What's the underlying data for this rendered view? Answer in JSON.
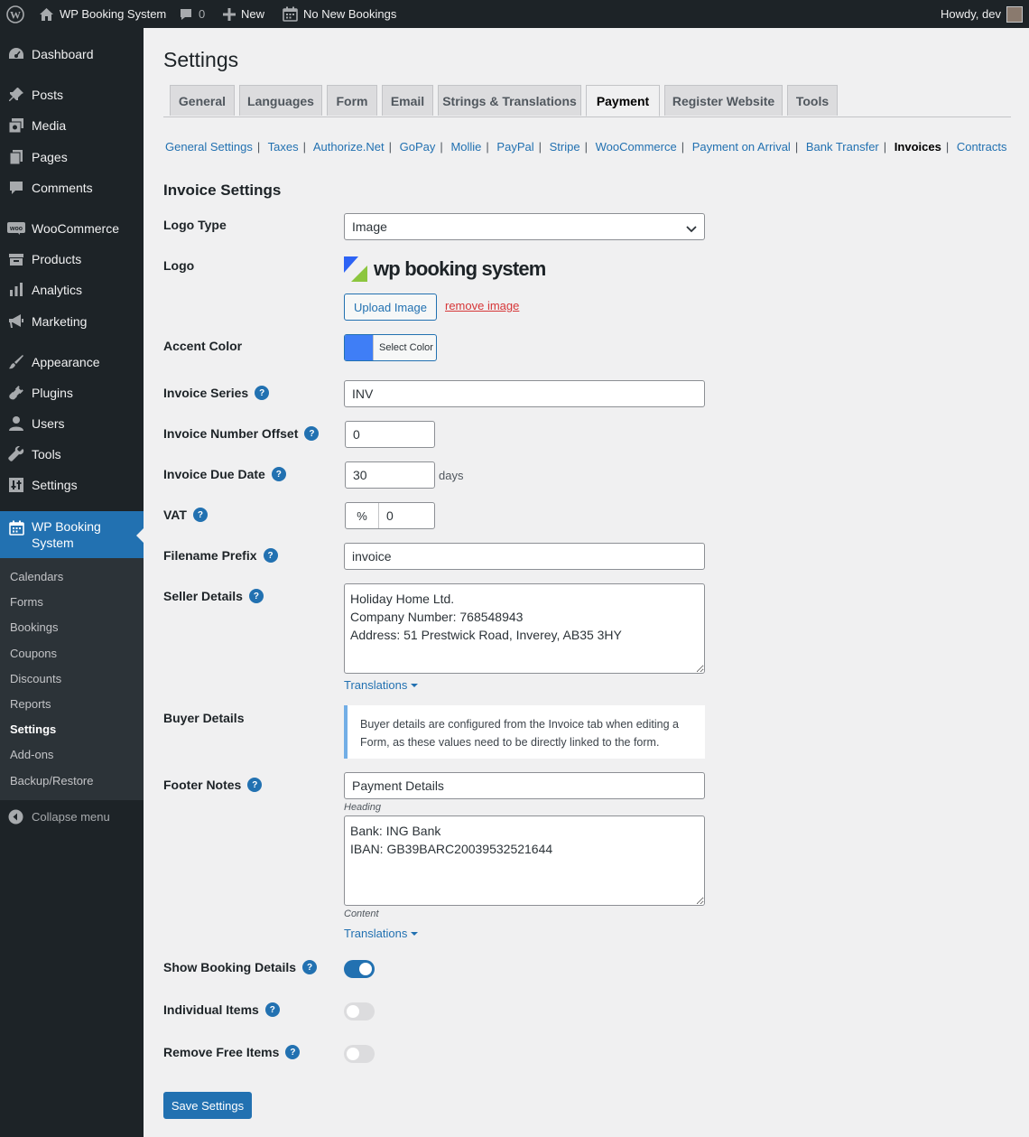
{
  "adminbar": {
    "site_name": "WP Booking System",
    "comments_count": "0",
    "new_label": "New",
    "bookings_label": "No New Bookings",
    "howdy": "Howdy, dev"
  },
  "sidebar": {
    "items": [
      {
        "label": "Dashboard",
        "icon": "dashboard-icon"
      },
      {
        "label": "Posts",
        "icon": "pin-icon"
      },
      {
        "label": "Media",
        "icon": "media-icon"
      },
      {
        "label": "Pages",
        "icon": "pages-icon"
      },
      {
        "label": "Comments",
        "icon": "comment-icon"
      },
      {
        "label": "WooCommerce",
        "icon": "woo-icon"
      },
      {
        "label": "Products",
        "icon": "archive-icon"
      },
      {
        "label": "Analytics",
        "icon": "chart-icon"
      },
      {
        "label": "Marketing",
        "icon": "megaphone-icon"
      },
      {
        "label": "Appearance",
        "icon": "brush-icon"
      },
      {
        "label": "Plugins",
        "icon": "plugin-icon"
      },
      {
        "label": "Users",
        "icon": "user-icon"
      },
      {
        "label": "Tools",
        "icon": "wrench-icon"
      },
      {
        "label": "Settings",
        "icon": "settings-icon"
      }
    ],
    "current": {
      "label_line1": "WP Booking",
      "label_line2": "System",
      "icon": "calendar-icon"
    },
    "submenu": [
      "Calendars",
      "Forms",
      "Bookings",
      "Coupons",
      "Discounts",
      "Reports",
      "Settings",
      "Add-ons",
      "Backup/Restore"
    ],
    "submenu_current": "Settings",
    "collapse": "Collapse menu"
  },
  "page": {
    "title": "Settings",
    "tabs": [
      "General",
      "Languages",
      "Form",
      "Email",
      "Strings & Translations",
      "Payment",
      "Register Website",
      "Tools"
    ],
    "active_tab": "Payment",
    "subnav": [
      "General Settings",
      "Taxes",
      "Authorize.Net",
      "GoPay",
      "Mollie",
      "PayPal",
      "Stripe",
      "WooCommerce",
      "Payment on Arrival",
      "Bank Transfer",
      "Invoices",
      "Contracts"
    ],
    "subnav_current": "Invoices",
    "section_title": "Invoice Settings"
  },
  "form": {
    "logo_type": {
      "label": "Logo Type",
      "value": "Image"
    },
    "logo": {
      "label": "Logo",
      "logo_text": "wp booking system",
      "upload_label": "Upload Image",
      "remove_label": "remove image"
    },
    "accent_color": {
      "label": "Accent Color",
      "button_label": "Select Color",
      "color": "#3f7ef6"
    },
    "invoice_series": {
      "label": "Invoice Series",
      "value": "INV"
    },
    "number_offset": {
      "label": "Invoice Number Offset",
      "value": "0"
    },
    "due_date": {
      "label": "Invoice Due Date",
      "value": "30",
      "suffix": "days"
    },
    "vat": {
      "label": "VAT",
      "prefix": "%",
      "value": "0"
    },
    "filename_prefix": {
      "label": "Filename Prefix",
      "value": "invoice"
    },
    "seller_details": {
      "label": "Seller Details",
      "value": "Holiday Home Ltd.\nCompany Number: 768548943\nAddress: 51 Prestwick Road, Inverey, AB35 3HY",
      "translations": "Translations"
    },
    "buyer_details": {
      "label": "Buyer Details",
      "notice": "Buyer details are configured from the Invoice tab when editing a Form, as these values need to be directly linked to the form."
    },
    "footer_notes": {
      "label": "Footer Notes",
      "heading_value": "Payment Details",
      "heading_caption": "Heading",
      "content_value": "Bank: ING Bank\nIBAN: GB39BARC20039532521644",
      "content_caption": "Content",
      "translations": "Translations"
    },
    "show_booking_details": {
      "label": "Show Booking Details",
      "enabled": true
    },
    "individual_items": {
      "label": "Individual Items",
      "enabled": false
    },
    "remove_free_items": {
      "label": "Remove Free Items",
      "enabled": false
    },
    "help_glyph": "?",
    "save_label": "Save Settings"
  },
  "colors": {
    "accent": "#2271b1",
    "sidebar_bg": "#1d2327",
    "submenu_bg": "#2c3338",
    "logo_blue": "#2d63f5",
    "logo_green": "#8cc63f"
  }
}
